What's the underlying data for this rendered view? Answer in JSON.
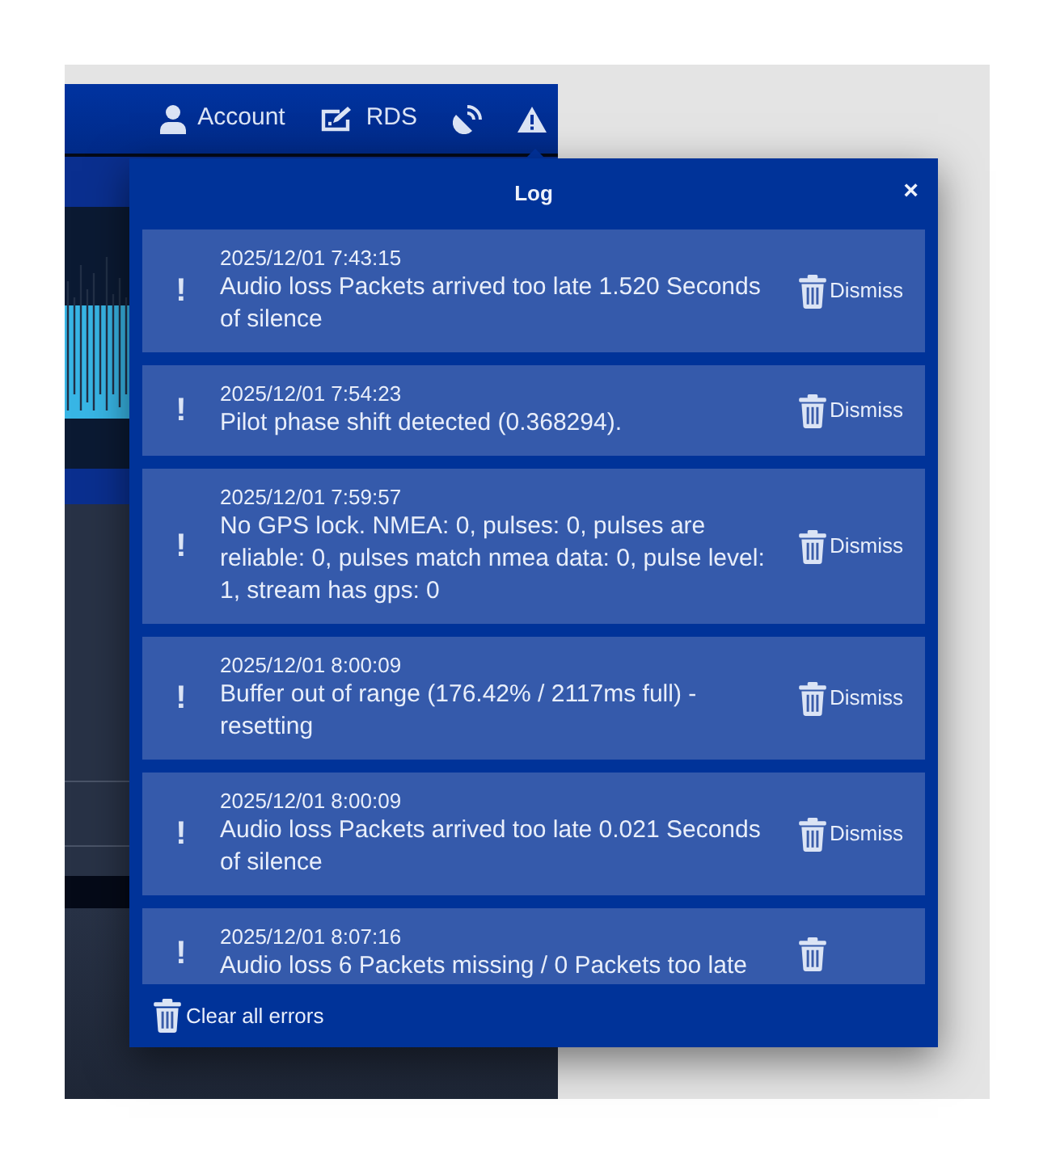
{
  "navbar": {
    "items": [
      {
        "kind": "user",
        "label": "Account"
      },
      {
        "kind": "edit",
        "label": "RDS"
      },
      {
        "kind": "satellite"
      },
      {
        "kind": "warning",
        "selected": true
      }
    ]
  },
  "log": {
    "title": "Log",
    "close": "×",
    "entries": [
      {
        "icon": "!",
        "timestamp": "2025/12/01 7:43:15",
        "message": "Audio loss Packets arrived too late 1.520 Seconds of silence",
        "action": "Dismiss"
      },
      {
        "icon": "!",
        "timestamp": "2025/12/01 7:54:23",
        "message": "Pilot phase shift detected (0.368294).",
        "action": "Dismiss"
      },
      {
        "icon": "!",
        "timestamp": "2025/12/01 7:59:57",
        "message": "No GPS lock. NMEA: 0, pulses: 0, pulses are reliable: 0, pulses match nmea data: 0, pulse level: 1, stream has gps: 0",
        "action": "Dismiss"
      },
      {
        "icon": "!",
        "timestamp": "2025/12/01 8:00:09",
        "message": "Buffer out of range (176.42% / 2117ms full) - resetting",
        "action": "Dismiss"
      },
      {
        "icon": "!",
        "timestamp": "2025/12/01 8:00:09",
        "message": "Audio loss Packets arrived too late 0.021 Seconds of silence",
        "action": "Dismiss"
      },
      {
        "icon": "!",
        "timestamp": "2025/12/01 8:07:16",
        "message": "Audio loss 6 Packets missing / 0 Packets too late"
      }
    ],
    "footer": "Clear all errors"
  }
}
